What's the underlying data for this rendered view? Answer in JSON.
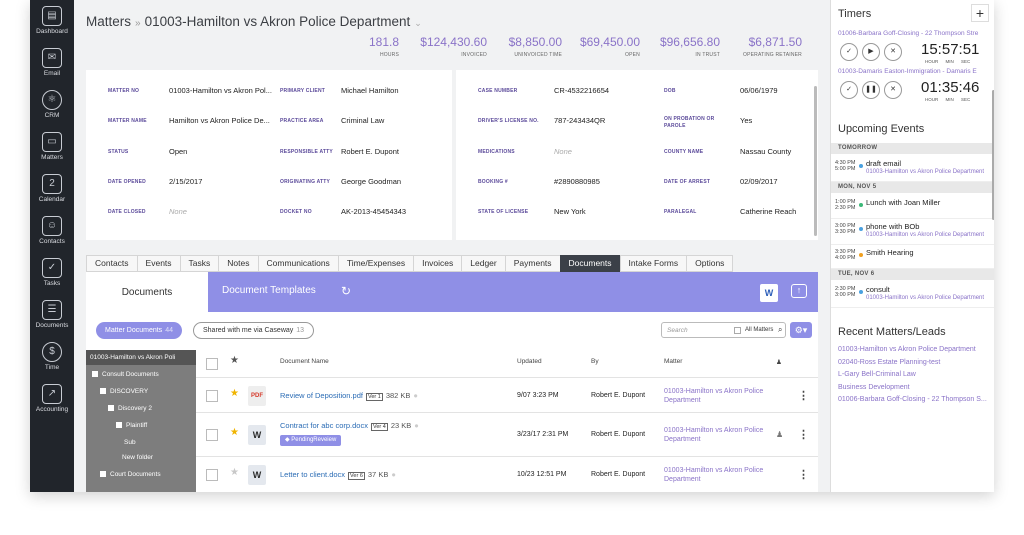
{
  "sidebar": {
    "items": [
      {
        "label": "Dashboard",
        "icon": "dashboard-icon",
        "glyph": "▤"
      },
      {
        "label": "Email",
        "icon": "email-icon",
        "glyph": "✉"
      },
      {
        "label": "CRM",
        "icon": "crm-icon",
        "glyph": "⚛"
      },
      {
        "label": "Matters",
        "icon": "matters-icon",
        "glyph": "▭"
      },
      {
        "label": "Calendar",
        "icon": "calendar-icon",
        "glyph": "2"
      },
      {
        "label": "Contacts",
        "icon": "contacts-icon",
        "glyph": "☺"
      },
      {
        "label": "Tasks",
        "icon": "tasks-icon",
        "glyph": "✓"
      },
      {
        "label": "Documents",
        "icon": "documents-icon",
        "glyph": "☰"
      },
      {
        "label": "Time",
        "icon": "time-icon",
        "glyph": "$"
      },
      {
        "label": "Accounting",
        "icon": "accounting-icon",
        "glyph": "↗"
      }
    ]
  },
  "breadcrumb": {
    "root": "Matters",
    "separator": "»",
    "current": "01003-Hamilton vs Akron Police Department"
  },
  "stats": [
    {
      "value": "181.8",
      "label": "HOURS"
    },
    {
      "value": "$124,430.60",
      "label": "INVOICED"
    },
    {
      "value": "$8,850.00",
      "label": "UNINVOICED TIME"
    },
    {
      "value": "$69,450.00",
      "label": "OPEN"
    },
    {
      "value": "$96,656.80",
      "label": "IN TRUST"
    },
    {
      "value": "$6,871.50",
      "label": "OPERATING RETAINER"
    }
  ],
  "matter": {
    "matter_no_label": "MATTER NO",
    "matter_no": "01003-Hamilton vs Akron Pol...",
    "matter_name_label": "MATTER NAME",
    "matter_name": "Hamilton vs Akron Police De...",
    "status_label": "STATUS",
    "status": "Open",
    "date_opened_label": "DATE OPENED",
    "date_opened": "2/15/2017",
    "date_closed_label": "DATE CLOSED",
    "date_closed": "None",
    "primary_client_label": "PRIMARY CLIENT",
    "primary_client": "Michael Hamilton",
    "practice_area_label": "PRACTICE AREA",
    "practice_area": "Criminal Law",
    "responsible_label": "RESPONSIBLE ATTY",
    "responsible": "Robert E. Dupont",
    "originating_label": "ORIGINATING ATTY",
    "originating": "George Goodman",
    "docket_label": "DOCKET NO",
    "docket": "AK-2013-45454343"
  },
  "case": {
    "case_number_label": "CASE NUMBER",
    "case_number": "CR-4532216654",
    "license_no_label": "DRIVER'S LICENSE NO.",
    "license_no": "787-243434QR",
    "medications_label": "MEDICATIONS",
    "medications": "None",
    "booking_label": "BOOKING #",
    "booking": "#2890880985",
    "license_state_label": "STATE OF LICENSE",
    "license_state": "New York",
    "dob_label": "DOB",
    "dob": "06/06/1979",
    "probation_label": "ON PROBATION OR PAROLE",
    "probation": "Yes",
    "county_label": "COUNTY NAME",
    "county": "Nassau County",
    "arrest_label": "DATE OF ARREST",
    "arrest": "02/09/2017",
    "paralegal_label": "PARALEGAL",
    "paralegal": "Catherine Reach"
  },
  "tabs": [
    "Contacts",
    "Events",
    "Tasks",
    "Notes",
    "Communications",
    "Time/Expenses",
    "Invoices",
    "Ledger",
    "Payments",
    "Documents",
    "Intake Forms",
    "Options"
  ],
  "active_tab": "Documents",
  "docs": {
    "documents_label": "Documents",
    "templates_label": "Document Templates",
    "word_glyph": "W",
    "matter_docs_label": "Matter Documents",
    "matter_docs_count": "44",
    "shared_label": "Shared with me via Caseway",
    "shared_count": "13",
    "search_placeholder": "Search",
    "all_matters_label": "All Matters"
  },
  "tree": {
    "root": "01003-Hamilton vs Akron Poli",
    "nodes": [
      "Consult Documents",
      "DISCOVERY",
      "Discovery 2",
      "Plaintiff",
      "Sub",
      "New folder",
      "Court Documents"
    ]
  },
  "table": {
    "headers": {
      "name": "Document Name",
      "updated": "Updated",
      "by": "By",
      "matter": "Matter"
    },
    "rows": [
      {
        "name": "Review of Deposition.pdf",
        "ver": "Ver 1",
        "size": "382 KB",
        "updated": "9/07 3:23 PM",
        "by": "Robert E. Dupont",
        "matter": "01003-Hamilton vs Akron Police Department",
        "type": "pdf",
        "starred": true
      },
      {
        "name": "Contract for abc corp.docx",
        "ver": "Ver 4",
        "size": "23 KB",
        "updated": "3/23/17 2:31 PM",
        "by": "Robert E. Dupont",
        "matter": "01003-Hamilton vs Akron Police Department",
        "type": "doc",
        "starred": true,
        "tag": "PendingReveiew"
      },
      {
        "name": "Letter to client.docx",
        "ver": "Ver 6",
        "size": "37 KB",
        "updated": "10/23 12:51 PM",
        "by": "Robert E. Dupont",
        "matter": "01003-Hamilton vs Akron Police Department",
        "type": "doc",
        "starred": false
      }
    ]
  },
  "timers": {
    "title": "Timers",
    "items": [
      {
        "name": "01006-Barbara Goff-Closing - 22 Thompson Stre",
        "time": "15:57:51",
        "state": "running"
      },
      {
        "name": "01003-Damaris Easton-Immigration - Damaris E",
        "time": "01:35:46",
        "state": "paused"
      }
    ],
    "units": "HOUR MIN SEC"
  },
  "upcoming": {
    "title": "Upcoming Events",
    "groups": [
      {
        "day": "TOMORROW",
        "events": [
          {
            "start": "4:30 PM",
            "end": "5:00 PM",
            "name": "draft email",
            "sub": "01003-Hamilton vs Akron Police Department",
            "color": "#4aa1e0"
          }
        ]
      },
      {
        "day": "MON, NOV 5",
        "events": [
          {
            "start": "1:00 PM",
            "end": "2:30 PM",
            "name": "Lunch with Joan Miller",
            "sub": "",
            "color": "#3cb878"
          },
          {
            "start": "3:00 PM",
            "end": "3:30 PM",
            "name": "phone with BOb",
            "sub": "01003-Hamilton vs Akron Police Department",
            "color": "#4aa1e0"
          },
          {
            "start": "3:30 PM",
            "end": "4:00 PM",
            "name": "Smith Hearing",
            "sub": "",
            "color": "#f0a020"
          }
        ]
      },
      {
        "day": "TUE, NOV 6",
        "events": [
          {
            "start": "2:30 PM",
            "end": "3:00 PM",
            "name": "consult",
            "sub": "01003-Hamilton vs Akron Police Department",
            "color": "#4aa1e0"
          }
        ]
      }
    ]
  },
  "recent": {
    "title": "Recent Matters/Leads",
    "items": [
      "01003-Hamilton vs Akron Police Department",
      "02040-Ross Estate Planning-test",
      "L-Gary Bell-Criminal Law",
      "Business Development",
      "01006-Barbara Goff-Closing - 22 Thompson S..."
    ]
  }
}
